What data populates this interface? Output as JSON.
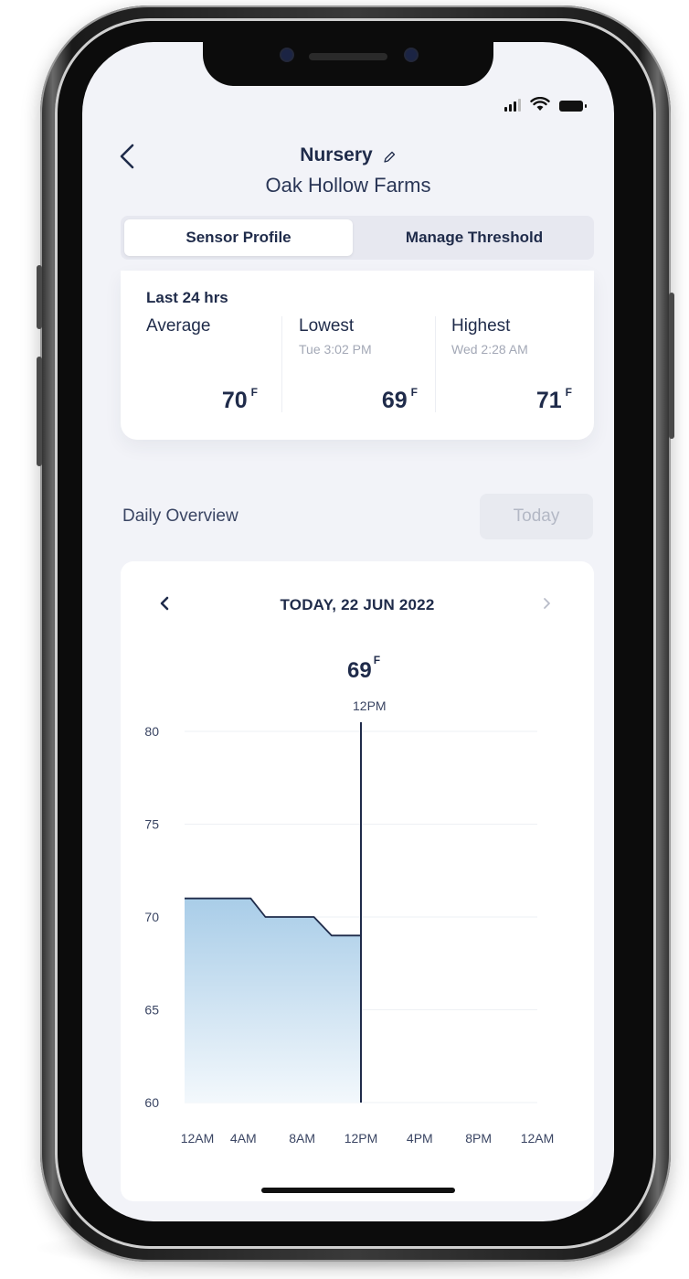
{
  "header": {
    "title": "Nursery",
    "subtitle": "Oak Hollow Farms"
  },
  "tabs": [
    {
      "label": "Sensor Profile",
      "active": true
    },
    {
      "label": "Manage Threshold",
      "active": false
    }
  ],
  "stats": {
    "period_label": "Last 24 hrs",
    "average": {
      "label": "Average",
      "value": "70",
      "unit": "F"
    },
    "lowest": {
      "label": "Lowest",
      "time": "Tue 3:02 PM",
      "value": "69",
      "unit": "F"
    },
    "highest": {
      "label": "Highest",
      "time": "Wed 2:28 AM",
      "value": "71",
      "unit": "F"
    }
  },
  "daily_overview": {
    "label": "Daily Overview",
    "today_button": "Today"
  },
  "chart_card": {
    "date": "TODAY, 22 JUN 2022",
    "selected_value": "69",
    "selected_unit": "F",
    "selected_time": "12PM"
  },
  "colors": {
    "primary": "#1f2b4a",
    "fill_top": "#a9cde8",
    "fill_bottom": "#f3f8fc",
    "line": "#1f2b4a",
    "screen_bg": "#f2f3f8"
  },
  "chart_data": {
    "type": "area",
    "title": "",
    "xlabel": "",
    "ylabel": "",
    "x_ticks": [
      "12AM",
      "4AM",
      "8AM",
      "12PM",
      "4PM",
      "8PM",
      "12AM"
    ],
    "y_ticks": [
      60,
      65,
      70,
      75,
      80
    ],
    "ylim": [
      60,
      80
    ],
    "xlim_hours": [
      0,
      24
    ],
    "grid": true,
    "cursor_hour": 12,
    "series": [
      {
        "x": [
          0,
          4.5,
          5.5,
          8.8,
          10,
          12
        ],
        "y": [
          71,
          71,
          70,
          70,
          69,
          69
        ]
      }
    ]
  }
}
